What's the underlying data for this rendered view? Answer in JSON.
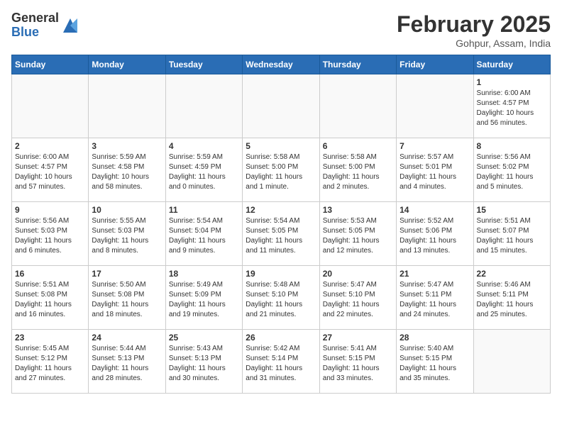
{
  "logo": {
    "general": "General",
    "blue": "Blue"
  },
  "title": "February 2025",
  "location": "Gohpur, Assam, India",
  "headers": [
    "Sunday",
    "Monday",
    "Tuesday",
    "Wednesday",
    "Thursday",
    "Friday",
    "Saturday"
  ],
  "weeks": [
    [
      {
        "day": "",
        "info": ""
      },
      {
        "day": "",
        "info": ""
      },
      {
        "day": "",
        "info": ""
      },
      {
        "day": "",
        "info": ""
      },
      {
        "day": "",
        "info": ""
      },
      {
        "day": "",
        "info": ""
      },
      {
        "day": "1",
        "info": "Sunrise: 6:00 AM\nSunset: 4:57 PM\nDaylight: 10 hours\nand 56 minutes."
      }
    ],
    [
      {
        "day": "2",
        "info": "Sunrise: 6:00 AM\nSunset: 4:57 PM\nDaylight: 10 hours\nand 57 minutes."
      },
      {
        "day": "3",
        "info": "Sunrise: 5:59 AM\nSunset: 4:58 PM\nDaylight: 10 hours\nand 58 minutes."
      },
      {
        "day": "4",
        "info": "Sunrise: 5:59 AM\nSunset: 4:59 PM\nDaylight: 11 hours\nand 0 minutes."
      },
      {
        "day": "5",
        "info": "Sunrise: 5:58 AM\nSunset: 5:00 PM\nDaylight: 11 hours\nand 1 minute."
      },
      {
        "day": "6",
        "info": "Sunrise: 5:58 AM\nSunset: 5:00 PM\nDaylight: 11 hours\nand 2 minutes."
      },
      {
        "day": "7",
        "info": "Sunrise: 5:57 AM\nSunset: 5:01 PM\nDaylight: 11 hours\nand 4 minutes."
      },
      {
        "day": "8",
        "info": "Sunrise: 5:56 AM\nSunset: 5:02 PM\nDaylight: 11 hours\nand 5 minutes."
      }
    ],
    [
      {
        "day": "9",
        "info": "Sunrise: 5:56 AM\nSunset: 5:03 PM\nDaylight: 11 hours\nand 6 minutes."
      },
      {
        "day": "10",
        "info": "Sunrise: 5:55 AM\nSunset: 5:03 PM\nDaylight: 11 hours\nand 8 minutes."
      },
      {
        "day": "11",
        "info": "Sunrise: 5:54 AM\nSunset: 5:04 PM\nDaylight: 11 hours\nand 9 minutes."
      },
      {
        "day": "12",
        "info": "Sunrise: 5:54 AM\nSunset: 5:05 PM\nDaylight: 11 hours\nand 11 minutes."
      },
      {
        "day": "13",
        "info": "Sunrise: 5:53 AM\nSunset: 5:05 PM\nDaylight: 11 hours\nand 12 minutes."
      },
      {
        "day": "14",
        "info": "Sunrise: 5:52 AM\nSunset: 5:06 PM\nDaylight: 11 hours\nand 13 minutes."
      },
      {
        "day": "15",
        "info": "Sunrise: 5:51 AM\nSunset: 5:07 PM\nDaylight: 11 hours\nand 15 minutes."
      }
    ],
    [
      {
        "day": "16",
        "info": "Sunrise: 5:51 AM\nSunset: 5:08 PM\nDaylight: 11 hours\nand 16 minutes."
      },
      {
        "day": "17",
        "info": "Sunrise: 5:50 AM\nSunset: 5:08 PM\nDaylight: 11 hours\nand 18 minutes."
      },
      {
        "day": "18",
        "info": "Sunrise: 5:49 AM\nSunset: 5:09 PM\nDaylight: 11 hours\nand 19 minutes."
      },
      {
        "day": "19",
        "info": "Sunrise: 5:48 AM\nSunset: 5:10 PM\nDaylight: 11 hours\nand 21 minutes."
      },
      {
        "day": "20",
        "info": "Sunrise: 5:47 AM\nSunset: 5:10 PM\nDaylight: 11 hours\nand 22 minutes."
      },
      {
        "day": "21",
        "info": "Sunrise: 5:47 AM\nSunset: 5:11 PM\nDaylight: 11 hours\nand 24 minutes."
      },
      {
        "day": "22",
        "info": "Sunrise: 5:46 AM\nSunset: 5:11 PM\nDaylight: 11 hours\nand 25 minutes."
      }
    ],
    [
      {
        "day": "23",
        "info": "Sunrise: 5:45 AM\nSunset: 5:12 PM\nDaylight: 11 hours\nand 27 minutes."
      },
      {
        "day": "24",
        "info": "Sunrise: 5:44 AM\nSunset: 5:13 PM\nDaylight: 11 hours\nand 28 minutes."
      },
      {
        "day": "25",
        "info": "Sunrise: 5:43 AM\nSunset: 5:13 PM\nDaylight: 11 hours\nand 30 minutes."
      },
      {
        "day": "26",
        "info": "Sunrise: 5:42 AM\nSunset: 5:14 PM\nDaylight: 11 hours\nand 31 minutes."
      },
      {
        "day": "27",
        "info": "Sunrise: 5:41 AM\nSunset: 5:15 PM\nDaylight: 11 hours\nand 33 minutes."
      },
      {
        "day": "28",
        "info": "Sunrise: 5:40 AM\nSunset: 5:15 PM\nDaylight: 11 hours\nand 35 minutes."
      },
      {
        "day": "",
        "info": ""
      }
    ]
  ]
}
